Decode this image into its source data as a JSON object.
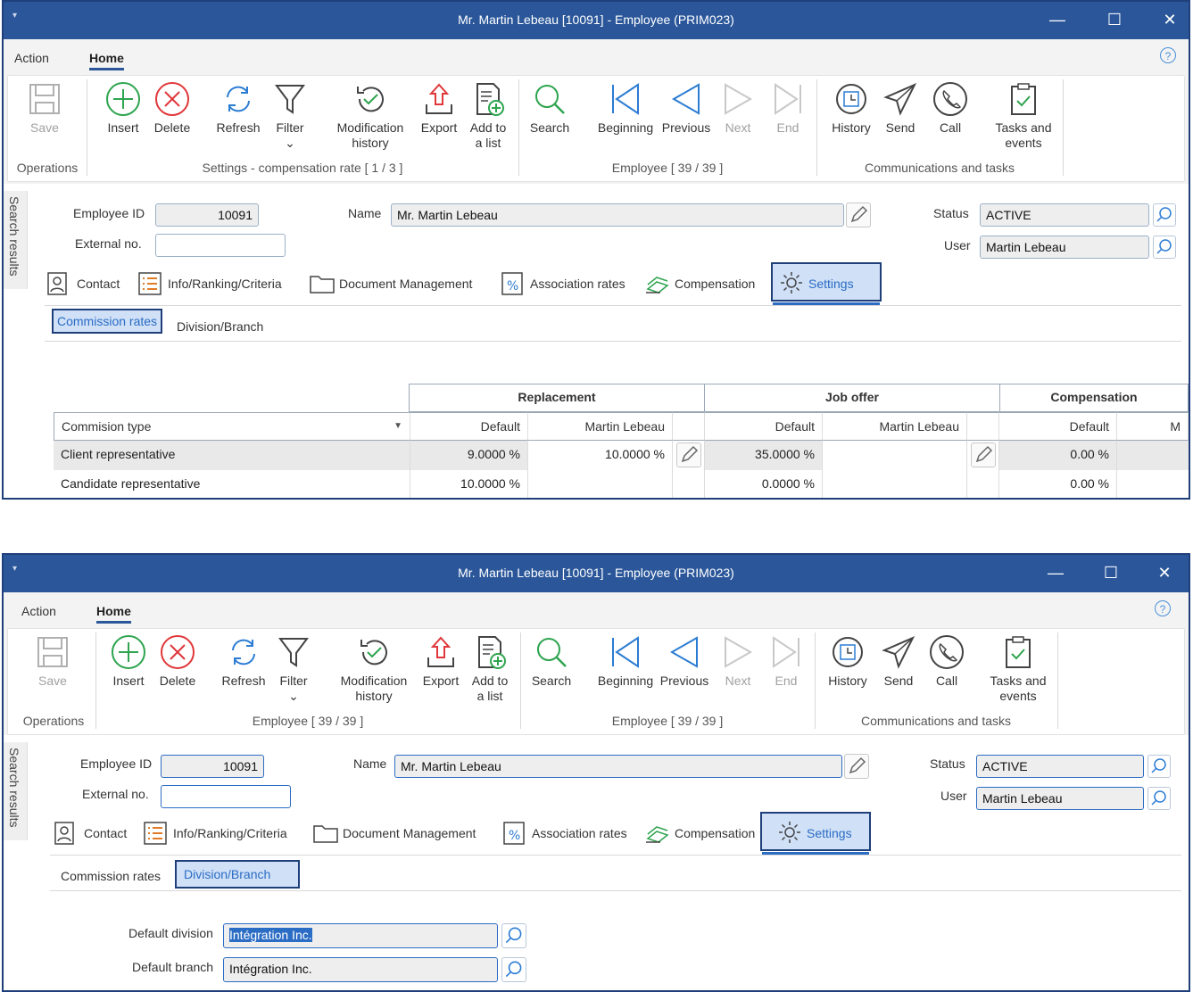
{
  "window": {
    "title": "Mr. Martin Lebeau [10091] - Employee (PRIM023)",
    "sysmenu": "▾",
    "minimize": "—",
    "maximize": "☐",
    "close": "✕"
  },
  "menu": {
    "action": "Action",
    "home": "Home",
    "help": "?"
  },
  "ribbon": {
    "save": "Save",
    "insert": "Insert",
    "delete": "Delete",
    "refresh": "Refresh",
    "filter": "Filter",
    "filter_arrow": "⌄",
    "modification_history_1": "Modification",
    "modification_history_2": "history",
    "export": "Export",
    "add_to_list_1": "Add to",
    "add_to_list_2": "a list",
    "search": "Search",
    "beginning": "Beginning",
    "previous": "Previous",
    "next": "Next",
    "end": "End",
    "history": "History",
    "send": "Send",
    "call": "Call",
    "tasks_events_1": "Tasks and",
    "tasks_events_2": "events",
    "group_operations": "Operations",
    "group_employee": "Employee [ 39 / 39 ]",
    "group_comms": "Communications and tasks"
  },
  "ribbon_top": {
    "group_settings": "Settings - compensation rate [ 1 / 3 ]"
  },
  "ribbon_bottom": {
    "group_employee2": "Employee [ 39 / 39 ]"
  },
  "side_tab": "Search results",
  "employee": {
    "id_label": "Employee ID",
    "id_value": "10091",
    "external_label": "External no.",
    "external_value": "",
    "name_label": "Name",
    "name_value": "Mr. Martin Lebeau",
    "status_label": "Status",
    "status_value": "ACTIVE",
    "user_label": "User",
    "user_value": "Martin Lebeau"
  },
  "tabs": {
    "contact": "Contact",
    "info": "Info/Ranking/Criteria",
    "documents": "Document Management",
    "association": "Association rates",
    "compensation": "Compensation",
    "settings": "Settings"
  },
  "subtabs": {
    "commission": "Commission rates",
    "division": "Division/Branch"
  },
  "grid": {
    "groups": [
      "Replacement",
      "Job offer",
      "Compensation"
    ],
    "col_type": "Commision type",
    "col_default": "Default",
    "col_person": "Martin Lebeau",
    "col_overflow": "M",
    "rows": [
      {
        "type": "Client representative",
        "rep_default": "9.0000 %",
        "rep_person": "10.0000 %",
        "job_default": "35.0000 %",
        "job_person": "",
        "comp_default": "0.00 %"
      },
      {
        "type": "Candidate representative",
        "rep_default": "10.0000 %",
        "rep_person": "",
        "job_default": "0.0000 %",
        "job_person": "",
        "comp_default": "0.00 %"
      }
    ]
  },
  "division": {
    "default_division_label": "Default division",
    "default_division_value": "Intégration Inc.",
    "default_branch_label": "Default branch",
    "default_branch_value": "Intégration Inc."
  },
  "colors": {
    "titlebar": "#2b579a",
    "accent": "#2b6cc4",
    "selected_tab": "#cfe0f7"
  }
}
